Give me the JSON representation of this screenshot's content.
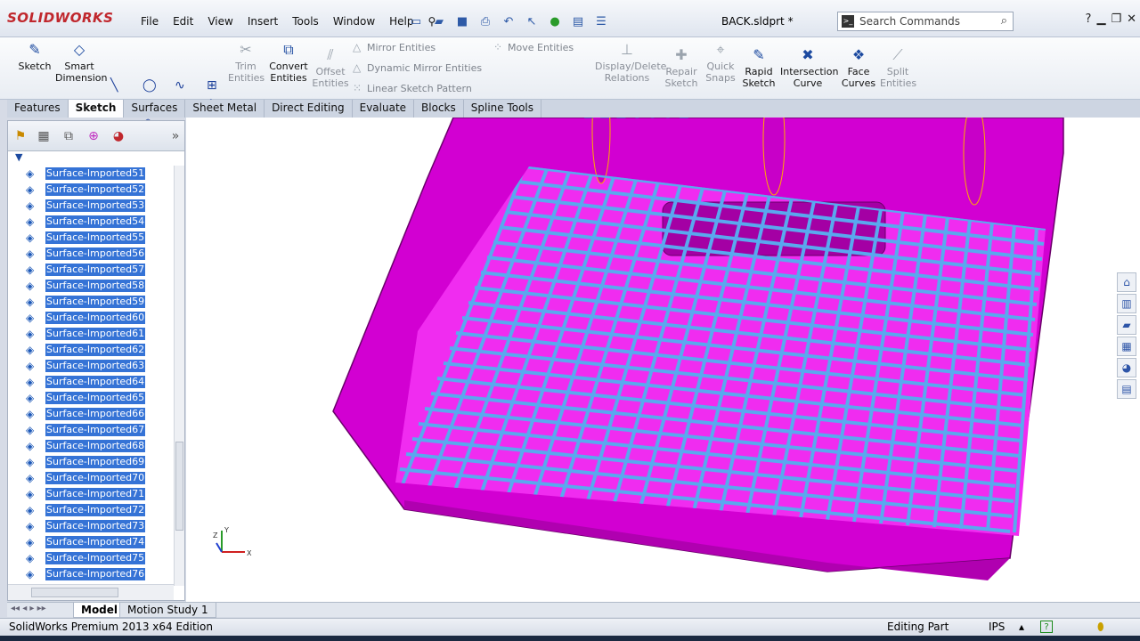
{
  "app": {
    "logo_text": "SOLIDWORKS",
    "document_title": "BACK.sldprt *"
  },
  "menu": [
    "File",
    "Edit",
    "View",
    "Insert",
    "Tools",
    "Window",
    "Help"
  ],
  "search": {
    "placeholder": "Search Commands"
  },
  "ribbon": {
    "sketch": "Sketch",
    "smart_dimension": "Smart Dimension",
    "trim_entities": "Trim Entities",
    "convert_entities": "Convert Entities",
    "offset_entities": "Offset Entities",
    "mirror_entities": "Mirror Entities",
    "dynamic_mirror_entities": "Dynamic Mirror Entities",
    "linear_sketch_pattern": "Linear Sketch Pattern",
    "move_entities": "Move Entities",
    "display_delete_relations": "Display/Delete Relations",
    "repair_sketch": "Repair Sketch",
    "quick_snaps": "Quick Snaps",
    "rapid_sketch": "Rapid Sketch",
    "intersection_curve": "Intersection Curve",
    "face_curves": "Face Curves",
    "split_entities": "Split Entities"
  },
  "tabs": [
    "Features",
    "Sketch",
    "Surfaces",
    "Sheet Metal",
    "Direct Editing",
    "Evaluate",
    "Blocks",
    "Spline Tools"
  ],
  "active_tab": "Sketch",
  "tree_items": [
    "Surface-Imported51",
    "Surface-Imported52",
    "Surface-Imported53",
    "Surface-Imported54",
    "Surface-Imported55",
    "Surface-Imported56",
    "Surface-Imported57",
    "Surface-Imported58",
    "Surface-Imported59",
    "Surface-Imported60",
    "Surface-Imported61",
    "Surface-Imported62",
    "Surface-Imported63",
    "Surface-Imported64",
    "Surface-Imported65",
    "Surface-Imported66",
    "Surface-Imported67",
    "Surface-Imported68",
    "Surface-Imported69",
    "Surface-Imported70",
    "Surface-Imported71",
    "Surface-Imported72",
    "Surface-Imported73",
    "Surface-Imported74",
    "Surface-Imported75",
    "Surface-Imported76"
  ],
  "bottom_tabs": {
    "model": "Model",
    "motion": "Motion Study 1"
  },
  "status": {
    "edition": "SolidWorks Premium 2013 x64 Edition",
    "mode": "Editing Part",
    "units": "IPS"
  },
  "triad": {
    "x": "X",
    "y": "Y",
    "z": "Z"
  },
  "colors": {
    "part": "#e600e6",
    "grid": "#5aa8ee",
    "selection": "#3573d6"
  }
}
